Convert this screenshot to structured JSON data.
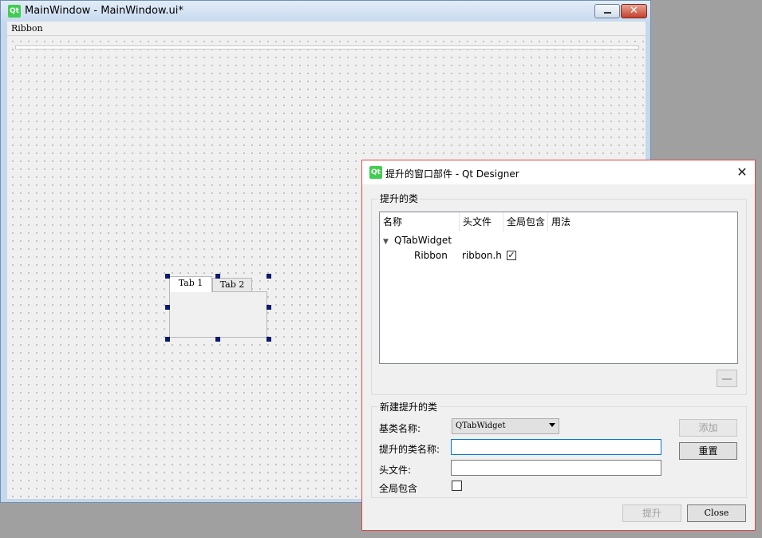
{
  "main_window": {
    "title": "MainWindow - MainWindow.ui*",
    "logo_text": "Qt",
    "menu": [
      "Ribbon"
    ],
    "tabs": [
      "Tab 1",
      "Tab 2"
    ],
    "close_glyph": "✕"
  },
  "dialog": {
    "title": "提升的窗口部件 - Qt Designer",
    "logo_text": "Qt",
    "close_glyph": "✕",
    "promoted_group_title": "提升的类",
    "columns": [
      "名称",
      "头文件",
      "全局包含",
      "用法"
    ],
    "tree": {
      "parent": "QTabWidget",
      "children": [
        {
          "name": "Ribbon",
          "header": "ribbon.h",
          "global_include": true,
          "usage": ""
        }
      ]
    },
    "new_group_title": "新建提升的类",
    "base_class_label": "基类名称:",
    "base_class_value": "QTabWidget",
    "promoted_class_label": "提升的类名称:",
    "promoted_class_value": "",
    "header_file_label": "头文件:",
    "header_file_value": "",
    "global_include_label": "全局包含",
    "global_include_checked": false,
    "add_button": "添加",
    "reset_button": "重置",
    "promote_button": "提升",
    "close_button": "Close"
  },
  "colors": {
    "qt_green": "#41cd52",
    "dialog_border": "#d94b4b",
    "focus_blue": "#0078d7",
    "selection_handle": "#0a1a6e"
  }
}
